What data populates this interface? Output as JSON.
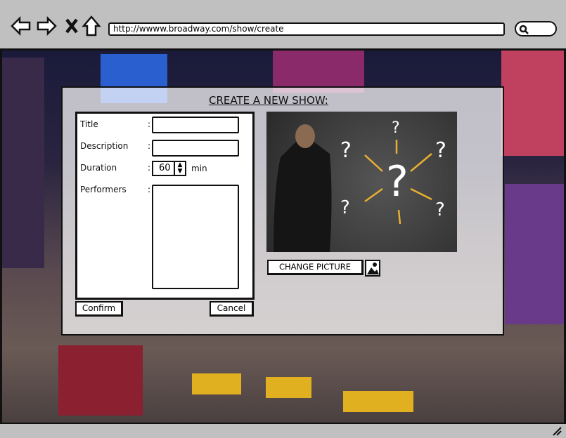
{
  "browser": {
    "url": "http://wwww.broadway.com/show/create",
    "icons": [
      "back-arrow-icon",
      "forward-arrow-icon",
      "close-x-icon",
      "home-icon",
      "search-icon"
    ]
  },
  "page": {
    "title": "CREATE A NEW SHOW:"
  },
  "form": {
    "title_label": "Title",
    "description_label": "Description",
    "duration_label": "Duration",
    "performers_label": "Performers",
    "colon": ":",
    "title_value": "",
    "description_value": "",
    "duration_value": "60",
    "duration_unit": "min",
    "performers_value": ""
  },
  "buttons": {
    "confirm": "Confirm",
    "cancel": "Cancel",
    "change_picture": "CHANGE PICTURE"
  },
  "picture": {
    "marks": [
      "?",
      "?",
      "?",
      "?",
      "?",
      "?"
    ]
  },
  "colors": {
    "chrome": "#c0c0c0",
    "border": "#111111"
  }
}
